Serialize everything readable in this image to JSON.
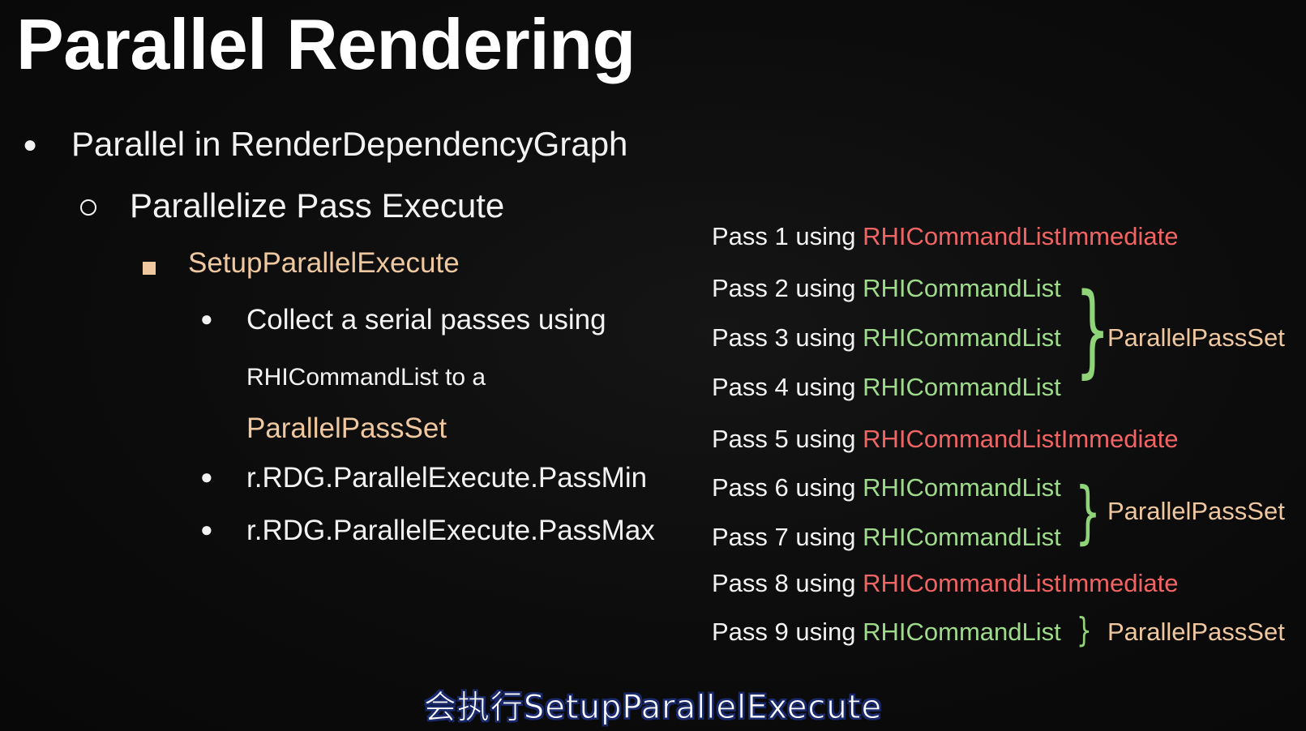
{
  "slide": {
    "title": "Parallel Rendering",
    "bullet1": "Parallel in RenderDependencyGraph",
    "bullet2": "Parallelize Pass Execute",
    "bullet3": "SetupParallelExecute",
    "sub_bullets": {
      "collect_line1": "Collect a serial passes using",
      "collect_line2": "RHICommandList to a",
      "collect_line3": "ParallelPassSet",
      "pass_min": "r.RDG.ParallelExecute.PassMin",
      "pass_max": "r.RDG.ParallelExecute.PassMax"
    }
  },
  "passes": [
    {
      "prefix": "Pass 1 using ",
      "list": "RHICommandListImmediate",
      "kind": "immediate"
    },
    {
      "prefix": "Pass 2 using ",
      "list": "RHICommandList",
      "kind": "parallel"
    },
    {
      "prefix": "Pass 3 using ",
      "list": "RHICommandList",
      "kind": "parallel"
    },
    {
      "prefix": "Pass 4 using ",
      "list": "RHICommandList",
      "kind": "parallel"
    },
    {
      "prefix": "Pass 5 using ",
      "list": "RHICommandListImmediate",
      "kind": "immediate"
    },
    {
      "prefix": "Pass 6 using ",
      "list": "RHICommandList",
      "kind": "parallel"
    },
    {
      "prefix": "Pass 7 using ",
      "list": "RHICommandList",
      "kind": "parallel"
    },
    {
      "prefix": "Pass 8 using ",
      "list": "RHICommandListImmediate",
      "kind": "immediate"
    },
    {
      "prefix": "Pass 9 using ",
      "list": "RHICommandList",
      "kind": "parallel"
    }
  ],
  "parallel_sets": [
    {
      "label": "ParallelPassSet"
    },
    {
      "label": "ParallelPassSet"
    },
    {
      "label": "ParallelPassSet"
    }
  ],
  "subtitle": "会执行SetupParallelExecute",
  "colors": {
    "immediate": "#f26464",
    "parallel": "#9edb8a",
    "highlight": "#f0c8a0",
    "brace": "#8fd479"
  }
}
